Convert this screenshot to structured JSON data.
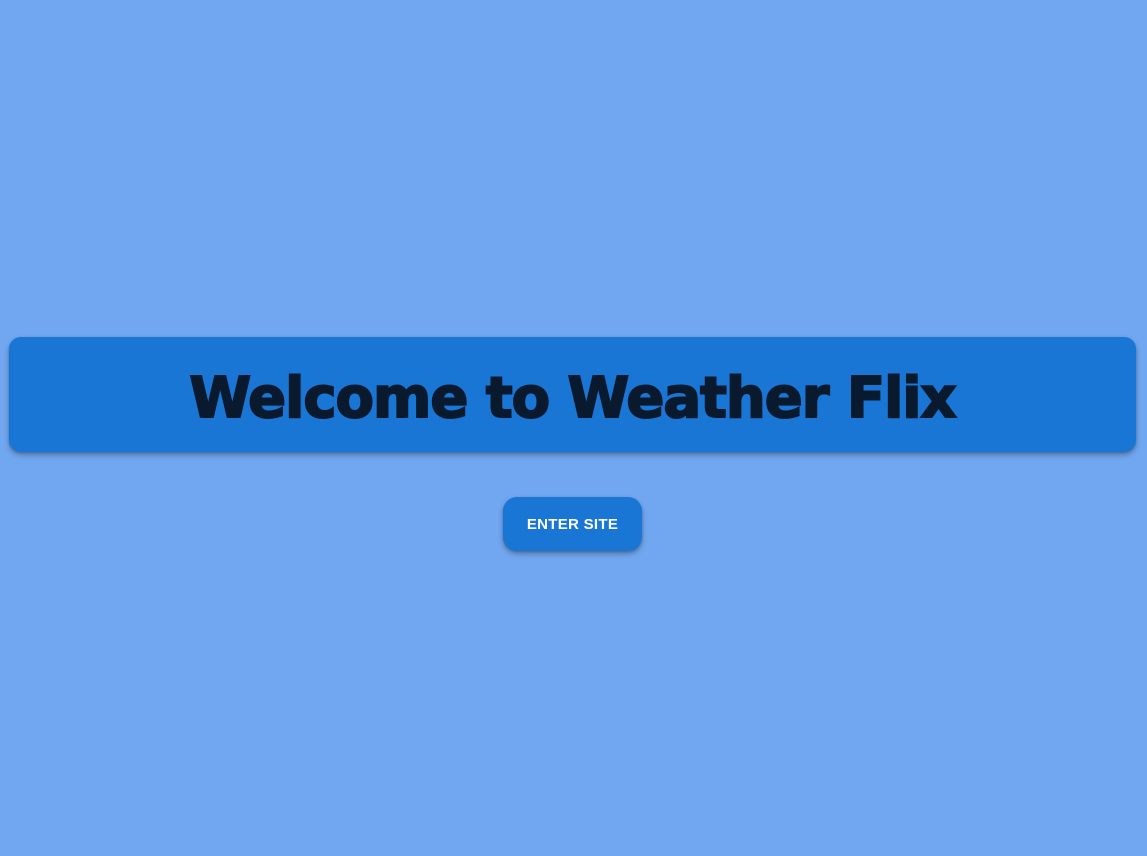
{
  "banner": {
    "title": "Welcome to Weather Flix"
  },
  "actions": {
    "enter_label": "ENTER SITE"
  },
  "colors": {
    "background": "#71a7f0",
    "accent": "#1976d4",
    "title_text": "#0a1a2e",
    "button_text": "#ffffff"
  }
}
